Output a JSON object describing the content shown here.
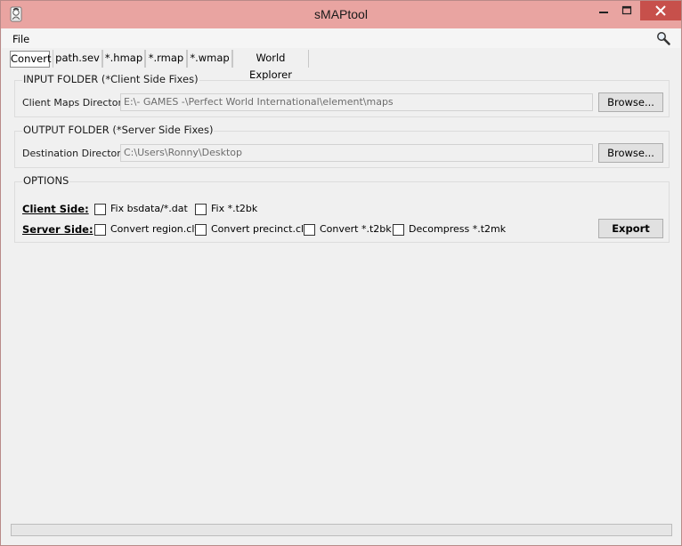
{
  "window": {
    "title": "sMAPtool"
  },
  "menu": {
    "file_label": "File"
  },
  "tabs": [
    "Convert",
    "path.sev",
    "*.hmap",
    "*.rmap",
    "*.wmap",
    "World Explorer"
  ],
  "input_group": {
    "title": "INPUT FOLDER (*Client Side Fixes)",
    "label": "Client Maps Directory:",
    "value": "E:\\- GAMES -\\Perfect World International\\element\\maps",
    "browse_label": "Browse..."
  },
  "output_group": {
    "title": "OUTPUT FOLDER (*Server Side Fixes)",
    "label": "Destination Directory:",
    "value": "C:\\Users\\Ronny\\Desktop",
    "browse_label": "Browse..."
  },
  "options": {
    "title": "OPTIONS",
    "client_side_label": "Client Side:",
    "server_side_label": "Server Side:",
    "client_checks": [
      {
        "label": "Fix bsdata/*.dat",
        "checked": false
      },
      {
        "label": "Fix *.t2bk",
        "checked": false
      }
    ],
    "server_checks": [
      {
        "label": "Convert region.clt",
        "checked": false
      },
      {
        "label": "Convert precinct.clt",
        "checked": false
      },
      {
        "label": "Convert *.t2bk",
        "checked": false
      },
      {
        "label": "Decompress *.t2mk",
        "checked": false
      }
    ],
    "export_label": "Export"
  },
  "colors": {
    "titlebar": "#e9a4a1",
    "close_button": "#c7504b",
    "window_bg": "#f0f0f0"
  },
  "icons": [
    "app-icon",
    "minimize-icon",
    "maximize-icon",
    "close-icon",
    "search-icon"
  ]
}
